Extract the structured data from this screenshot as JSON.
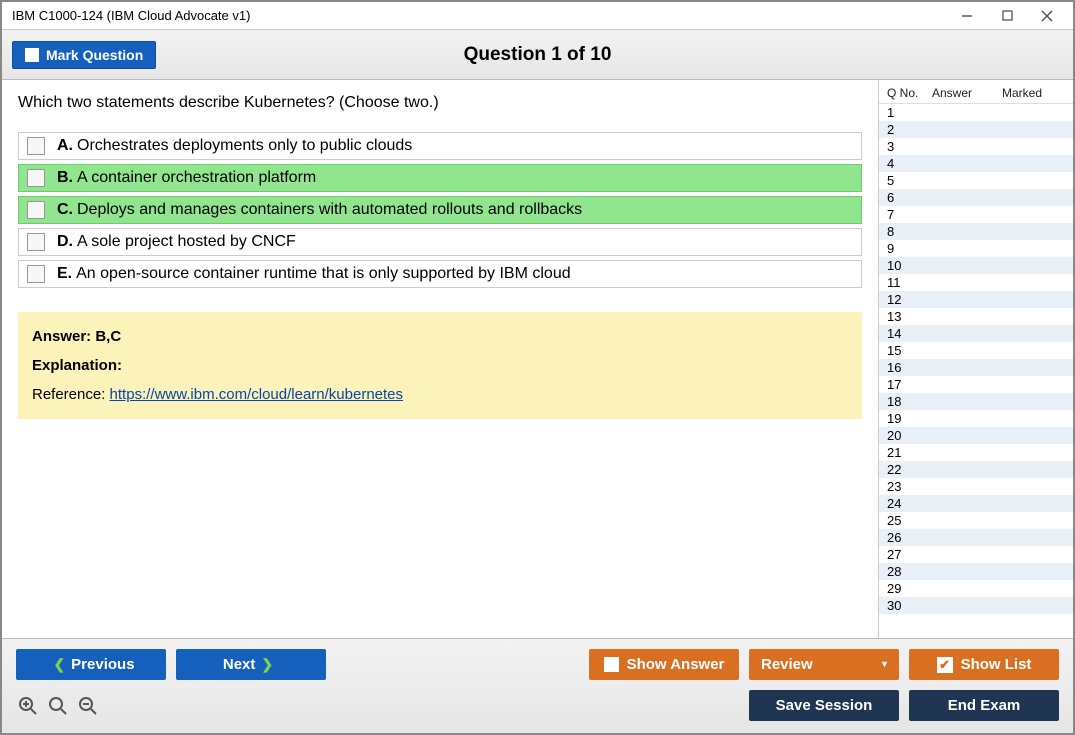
{
  "window": {
    "title": "IBM C1000-124 (IBM Cloud Advocate v1)"
  },
  "topbar": {
    "mark_label": "Mark Question",
    "question_header": "Question 1 of 10"
  },
  "question": {
    "prompt": "Which two statements describe Kubernetes? (Choose two.)",
    "options": [
      {
        "letter": "A.",
        "text": "Orchestrates deployments only to public clouds",
        "correct": false
      },
      {
        "letter": "B.",
        "text": "A container orchestration platform",
        "correct": true
      },
      {
        "letter": "C.",
        "text": "Deploys and manages containers with automated rollouts and rollbacks",
        "correct": true
      },
      {
        "letter": "D.",
        "text": "A sole project hosted by CNCF",
        "correct": false
      },
      {
        "letter": "E.",
        "text": "An open-source container runtime that is only supported by IBM cloud",
        "correct": false
      }
    ]
  },
  "explanation": {
    "answer_label": "Answer: B,C",
    "heading": "Explanation:",
    "reference_prefix": "Reference: ",
    "reference_link": "https://www.ibm.com/cloud/learn/kubernetes"
  },
  "sidebar": {
    "columns": {
      "qno": "Q No.",
      "answer": "Answer",
      "marked": "Marked"
    },
    "rows": [
      {
        "no": "1"
      },
      {
        "no": "2"
      },
      {
        "no": "3"
      },
      {
        "no": "4"
      },
      {
        "no": "5"
      },
      {
        "no": "6"
      },
      {
        "no": "7"
      },
      {
        "no": "8"
      },
      {
        "no": "9"
      },
      {
        "no": "10"
      },
      {
        "no": "11"
      },
      {
        "no": "12"
      },
      {
        "no": "13"
      },
      {
        "no": "14"
      },
      {
        "no": "15"
      },
      {
        "no": "16"
      },
      {
        "no": "17"
      },
      {
        "no": "18"
      },
      {
        "no": "19"
      },
      {
        "no": "20"
      },
      {
        "no": "21"
      },
      {
        "no": "22"
      },
      {
        "no": "23"
      },
      {
        "no": "24"
      },
      {
        "no": "25"
      },
      {
        "no": "26"
      },
      {
        "no": "27"
      },
      {
        "no": "28"
      },
      {
        "no": "29"
      },
      {
        "no": "30"
      }
    ]
  },
  "footer": {
    "previous": "Previous",
    "next": "Next",
    "show_answer": "Show Answer",
    "review": "Review",
    "show_list": "Show List",
    "save_session": "Save Session",
    "end_exam": "End Exam"
  }
}
